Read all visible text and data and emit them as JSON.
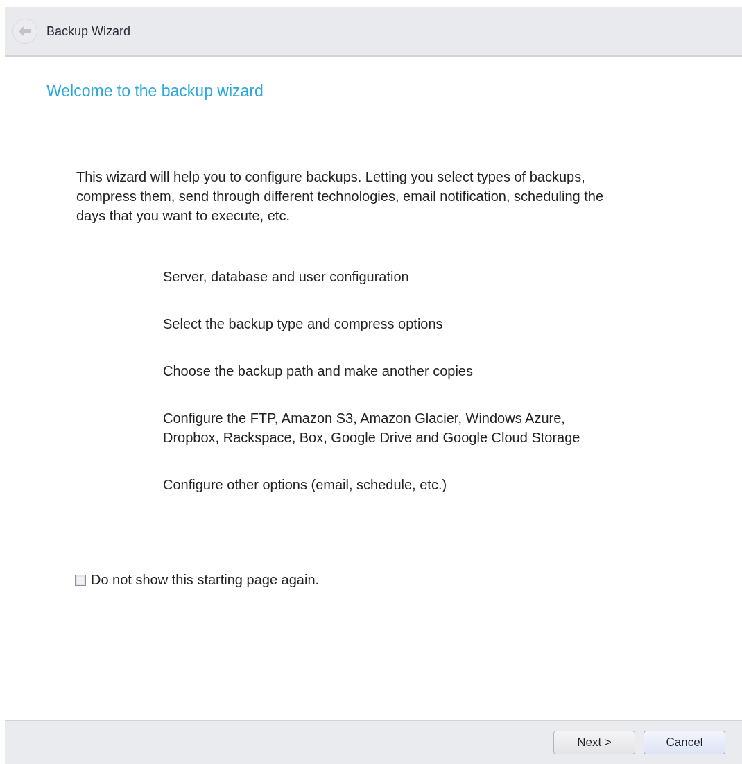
{
  "header": {
    "title": "Backup Wizard",
    "back_button": {
      "disabled": true
    }
  },
  "heading": "Welcome to the backup wizard",
  "intro": [
    "This wizard will help you to configure backups. Letting you select types of backups,",
    "compress them, send through different technologies, email notification, scheduling the",
    "days that you want to execute, etc."
  ],
  "steps": [
    {
      "lines": [
        "Server, database and user configuration"
      ]
    },
    {
      "lines": [
        "Select the backup type and compress options"
      ]
    },
    {
      "lines": [
        "Choose the backup path and make another copies"
      ]
    },
    {
      "lines": [
        "Configure the FTP, Amazon S3, Amazon Glacier, Windows Azure,",
        "Dropbox, Rackspace, Box, Google Drive and Google Cloud Storage"
      ]
    },
    {
      "lines": [
        "Configure other options (email, schedule, etc.)"
      ]
    }
  ],
  "checkbox": {
    "label": "Do not show this starting page again.",
    "checked": false
  },
  "buttons": [
    {
      "label": "Next >",
      "default": false
    },
    {
      "label": "Cancel",
      "default": true
    }
  ]
}
